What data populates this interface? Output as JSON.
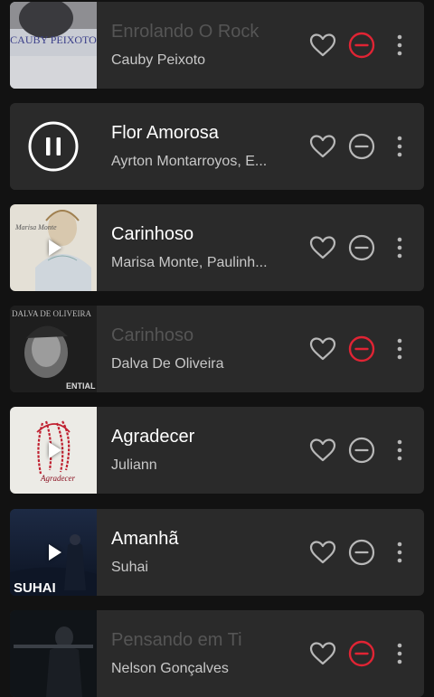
{
  "tracks": [
    {
      "title": "Enrolando O Rock",
      "artist": "Cauby Peixoto",
      "art_text": "CAUBY PEIXOTO",
      "state": "unavailable",
      "art": "cauby"
    },
    {
      "title": "Flor Amorosa",
      "artist": "Ayrton Montarroyos, E...",
      "state": "playing",
      "art": "pause"
    },
    {
      "title": "Carinhoso",
      "artist": "Marisa Monte, Paulinh...",
      "art_text": "Marisa Monte",
      "state": "available",
      "art": "marisa"
    },
    {
      "title": "Carinhoso",
      "artist": "Dalva De Oliveira",
      "art_text": "DALVA DE OLIVEIRA",
      "art_text2": "ENTIAL",
      "state": "unavailable",
      "art": "dalva"
    },
    {
      "title": "Agradecer",
      "artist": "Juliann",
      "art_text": "Agradecer",
      "state": "available",
      "art": "agradecer"
    },
    {
      "title": "Amanhã",
      "artist": "Suhai",
      "art_text": "SUHAI",
      "state": "available",
      "art": "suhai"
    },
    {
      "title": "Pensando em Ti",
      "artist": "Nelson Gonçalves",
      "state": "unavailable",
      "art": "nelson"
    }
  ],
  "colors": {
    "card": "#2a2a2a",
    "remove_active": "#e02434",
    "icon": "#b8b8b8",
    "title_dim": "#555555"
  }
}
